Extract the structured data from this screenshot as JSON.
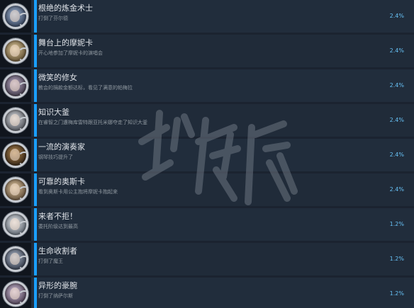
{
  "achievements": [
    {
      "title": "根绝的炼金术士",
      "desc": "打倒了芬尔德",
      "percent": "2.4%",
      "colors": {
        "bg": "#3c4a63",
        "accent": "#9fb3cf"
      }
    },
    {
      "title": "舞台上的摩妮卡",
      "desc": "开心地参加了摩妮卡的演唱会",
      "percent": "2.4%",
      "colors": {
        "bg": "#6d5b3c",
        "accent": "#d9c59a"
      }
    },
    {
      "title": "微笑的修女",
      "desc": "教会的捐款金额达标，看见了满意的帕梅拉",
      "percent": "2.4%",
      "colors": {
        "bg": "#4a4353",
        "accent": "#b7a8c2"
      }
    },
    {
      "title": "知识大釜",
      "desc": "在睿智之门遭梅库雷特跟亚托米娜夺走了知识大釜",
      "percent": "2.4%",
      "colors": {
        "bg": "#5e6168",
        "accent": "#d2d4d8"
      }
    },
    {
      "title": "一流的演奏家",
      "desc": "钢琴技巧提升了",
      "percent": "2.4%",
      "colors": {
        "bg": "#3d2c1b",
        "accent": "#b0864f"
      }
    },
    {
      "title": "可靠的奥斯卡",
      "desc": "看到奥斯卡用公主抱将摩妮卡抱起来",
      "percent": "2.4%",
      "colors": {
        "bg": "#6e5a44",
        "accent": "#d8c09b"
      }
    },
    {
      "title": "来者不拒！",
      "desc": "委托阶级达到最高",
      "percent": "1.2%",
      "colors": {
        "bg": "#6a727c",
        "accent": "#e1e3e6"
      }
    },
    {
      "title": "生命收割者",
      "desc": "打倒了魔王",
      "percent": "1.2%",
      "colors": {
        "bg": "#3e4656",
        "accent": "#aab4c4"
      }
    },
    {
      "title": "异形的豪腕",
      "desc": "打倒了纳萨尔斯",
      "percent": "1.2%",
      "colors": {
        "bg": "#574a5e",
        "accent": "#cfbfd6"
      }
    }
  ],
  "colors": {
    "accent_bar": "#1a9fff",
    "percent_text": "#67c1f5",
    "row_bg": "#212d3c"
  }
}
